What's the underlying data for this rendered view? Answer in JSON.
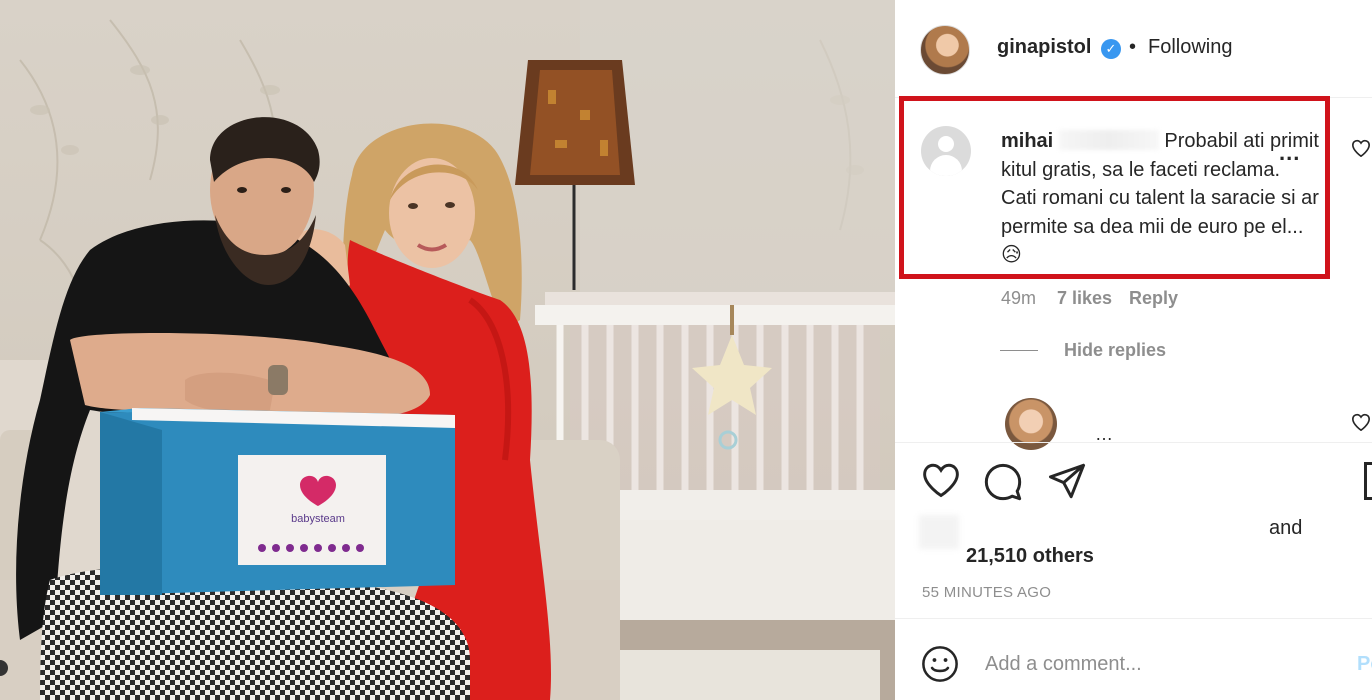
{
  "post": {
    "username": "ginapistol",
    "separator": "•",
    "follow_status": "Following",
    "verified_icon": "verified-badge-icon"
  },
  "comment": {
    "username": "mihai",
    "text": "Probabil ati primit kitul gratis, sa le faceti reclama. Cati romani cu talent la saracie si ar permite sa dea mii de euro pe el...",
    "emoji": "😥",
    "more": "...",
    "time": "49m",
    "likes": "7 likes",
    "reply": "Reply",
    "highlight_color": "#d0131b"
  },
  "replies": {
    "toggle": "Hide replies",
    "partial_text": "…"
  },
  "likes": {
    "and": "and",
    "others": "21,510 others"
  },
  "timestamp": "55 MINUTES AGO",
  "add_comment": {
    "placeholder": "Add a comment...",
    "post_label": "Po"
  },
  "product_box": {
    "brand": "babysteam"
  },
  "icons": [
    "heart-icon",
    "comment-icon",
    "share-icon",
    "bookmark-icon",
    "emoji-icon",
    "more-options-icon"
  ]
}
